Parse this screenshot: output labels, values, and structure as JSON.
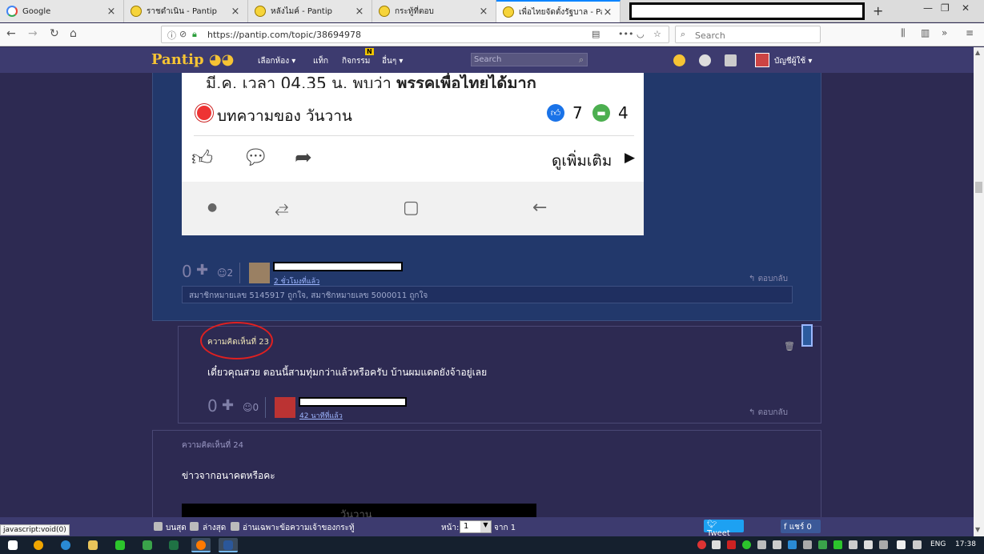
{
  "browser": {
    "tabs": [
      {
        "label": "Google",
        "favicon": "google-icon"
      },
      {
        "label": "ราชดำเนิน - Pantip",
        "favicon": "pantip-icon"
      },
      {
        "label": "หลังไมค์ - Pantip",
        "favicon": "pantip-icon"
      },
      {
        "label": "กระทู้ที่ตอบ",
        "favicon": "pantip-icon"
      },
      {
        "label": "เพื่อไทยจัดตั้งรัฐบาล - Pant",
        "favicon": "pantip-icon",
        "active": true
      }
    ],
    "url": "https://pantip.com/topic/38694978",
    "search_placeholder": "Search"
  },
  "site": {
    "logo": "Pantip",
    "nav": [
      "เลือกห้อง ▾",
      "แท็ก",
      "กิจกรรม",
      "อื่นๆ ▾"
    ],
    "activity_badge": "N",
    "search_placeholder": "Search",
    "account_label": "บัญชีผู้ใช้ ▾",
    "accent": "#3d3b6f"
  },
  "post22": {
    "embed": {
      "cut_text_prefix": "มี.ค. เวลา 04.35 น. พบว่า ",
      "cut_text_bold": "พรรคเพื่อไทยได้มาก",
      "author": "บทความของ วันวาน",
      "likes": "7",
      "comments": "4",
      "more": "ดูเพิ่มเติม"
    },
    "votes": "0",
    "emotions": "2",
    "time_ago": "2 ชั่วโมงที่แล้ว",
    "reply": "ตอบกลับ",
    "likes_text": "สมาชิกหมายเลข 5145917 ถูกใจ, สมาชิกหมายเลข 5000011 ถูกใจ"
  },
  "post23": {
    "title": "ความคิดเห็นที่ 23",
    "body": "เดี๋ยวคุณสวย ตอนนี้สามทุ่มกว่าแล้วหรือครับ บ้านผมแดดยังจ้าอยู่เลย",
    "votes": "0",
    "emotions": "0",
    "time_ago": "42 นาทีที่แล้ว",
    "reply": "ตอบกลับ"
  },
  "post24": {
    "title": "ความคิดเห็นที่ 24",
    "body": "ข่าวจากอนาคตหรือคะ",
    "embed_text": "วันวาน"
  },
  "bottombar": {
    "top": "บนสุด",
    "bottom": "ล่างสุด",
    "owner_only": "อ่านเฉพาะข้อความเจ้าของกระทู้",
    "page_label": "หน้า:",
    "page_value": "1",
    "page_of": "จาก 1",
    "tweet": "Tweet",
    "share": "แชร์ 0"
  },
  "status_tip": "javascript:void(0)",
  "taskbar": {
    "lang": "ENG",
    "time": "17:38"
  }
}
